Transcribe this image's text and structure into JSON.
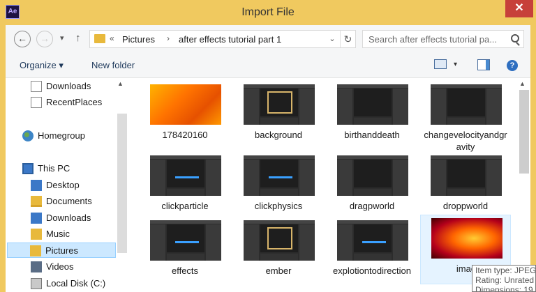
{
  "window": {
    "app_icon_text": "Ae",
    "title": "Import File",
    "close_glyph": "✕"
  },
  "nav": {
    "back_glyph": "←",
    "forward_glyph": "→",
    "recent_glyph": "▾",
    "up_glyph": "↑",
    "breadcrumb_overflow": "«",
    "breadcrumb": [
      "Pictures",
      "after effects tutorial part 1"
    ],
    "breadcrumb_sep": "›",
    "dropdown_glyph": "⌄",
    "refresh_glyph": "↻"
  },
  "search": {
    "placeholder": "Search after effects tutorial pa..."
  },
  "toolbar": {
    "organize_label": "Organize ▾",
    "new_folder_label": "New folder",
    "views_dd": "▾",
    "help_glyph": "?"
  },
  "sidebar": {
    "scroll_up_glyph": "▲",
    "items": [
      {
        "label": "Downloads",
        "icon": "document-icon"
      },
      {
        "label": "RecentPlaces",
        "icon": "document-icon"
      },
      {
        "label": "Homegroup",
        "icon": "homegroup-icon"
      },
      {
        "label": "This PC",
        "icon": "computer-icon"
      },
      {
        "label": "Desktop",
        "icon": "desktop-folder-icon"
      },
      {
        "label": "Documents",
        "icon": "documents-folder-icon"
      },
      {
        "label": "Downloads",
        "icon": "downloads-folder-icon"
      },
      {
        "label": "Music",
        "icon": "music-folder-icon"
      },
      {
        "label": "Pictures",
        "icon": "pictures-folder-icon",
        "selected": true
      },
      {
        "label": "Videos",
        "icon": "videos-folder-icon"
      },
      {
        "label": "Local Disk (C:)",
        "icon": "drive-icon"
      }
    ]
  },
  "files": {
    "scroll_up_glyph": "▲",
    "items": [
      {
        "label": "178420160",
        "thumb": "fire"
      },
      {
        "label": "background",
        "thumb": "ae-frame"
      },
      {
        "label": "birthanddeath",
        "thumb": "ae"
      },
      {
        "label": "changevelocityandgravity",
        "thumb": "ae"
      },
      {
        "label": "clickparticle",
        "thumb": "ae-wave"
      },
      {
        "label": "clickphysics",
        "thumb": "ae-wave"
      },
      {
        "label": "dragpworld",
        "thumb": "ae"
      },
      {
        "label": "droppworld",
        "thumb": "ae"
      },
      {
        "label": "effects",
        "thumb": "ae"
      },
      {
        "label": "ember",
        "thumb": "ae-frame"
      },
      {
        "label": "explotiontodirection",
        "thumb": "ae"
      },
      {
        "label": "imag",
        "thumb": "fire2",
        "hover": true
      }
    ]
  },
  "tooltip": {
    "line1": "Item type: JPEG",
    "line2": "Rating: Unrated",
    "line3": "Dimensions: 19"
  }
}
